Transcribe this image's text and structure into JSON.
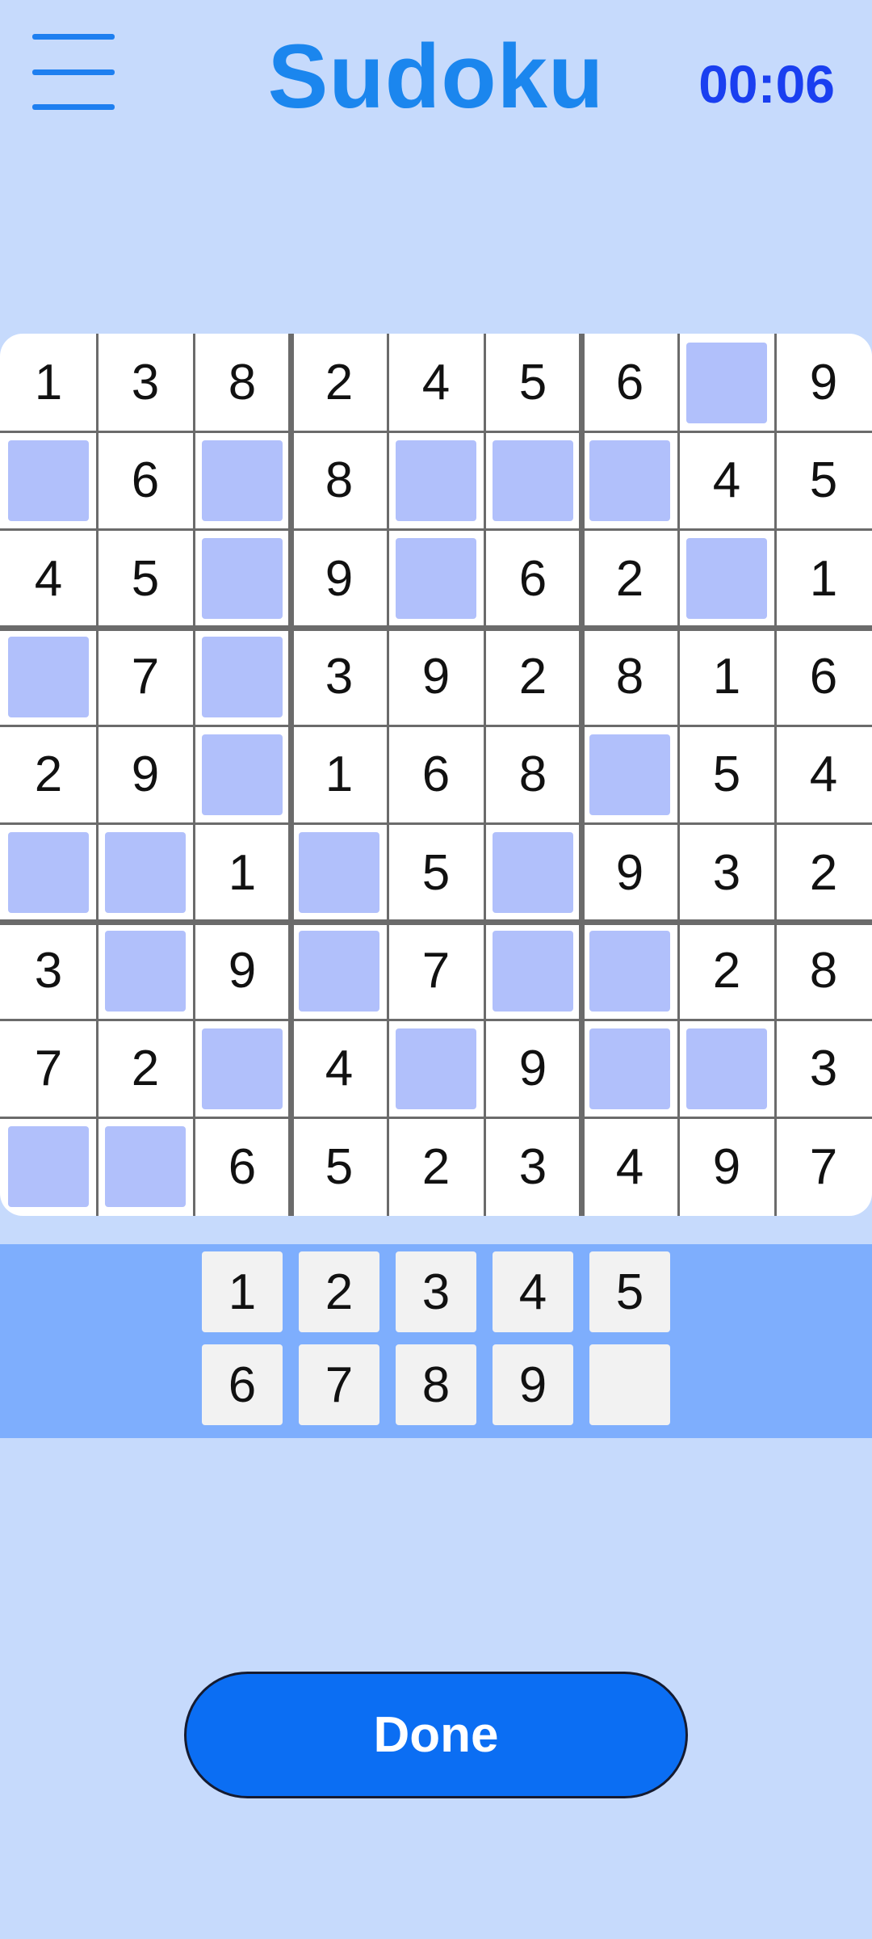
{
  "header": {
    "menu_icon": "hamburger-menu-icon",
    "title": "Sudoku",
    "timer": "00:06"
  },
  "board": {
    "rows": [
      [
        "1",
        "3",
        "8",
        "2",
        "4",
        "5",
        "6",
        "",
        "9"
      ],
      [
        "",
        "6",
        "",
        "8",
        "",
        "",
        "",
        "4",
        "5"
      ],
      [
        "4",
        "5",
        "",
        "9",
        "",
        "6",
        "2",
        "",
        "1"
      ],
      [
        "",
        "7",
        "",
        "3",
        "9",
        "2",
        "8",
        "1",
        "6"
      ],
      [
        "2",
        "9",
        "",
        "1",
        "6",
        "8",
        "",
        "5",
        "4"
      ],
      [
        "",
        "",
        "1",
        "",
        "5",
        "",
        "9",
        "3",
        "2"
      ],
      [
        "3",
        "",
        "9",
        "",
        "7",
        "",
        "",
        "2",
        "8"
      ],
      [
        "7",
        "2",
        "",
        "4",
        "",
        "9",
        "",
        "",
        "3"
      ],
      [
        "",
        "",
        "6",
        "5",
        "2",
        "3",
        "4",
        "9",
        "7"
      ]
    ]
  },
  "numpad": {
    "keys": [
      "1",
      "2",
      "3",
      "4",
      "5",
      "6",
      "7",
      "8",
      "9",
      ""
    ]
  },
  "done_label": "Done",
  "colors": {
    "background": "#c6dafc",
    "title": "#1b86ee",
    "timer": "#1a3ff0",
    "empty_cell": "#b1c0fb",
    "numpad_bar": "#7eaefd",
    "numpad_key": "#f2f2f2",
    "done_button": "#0b6ef3"
  }
}
